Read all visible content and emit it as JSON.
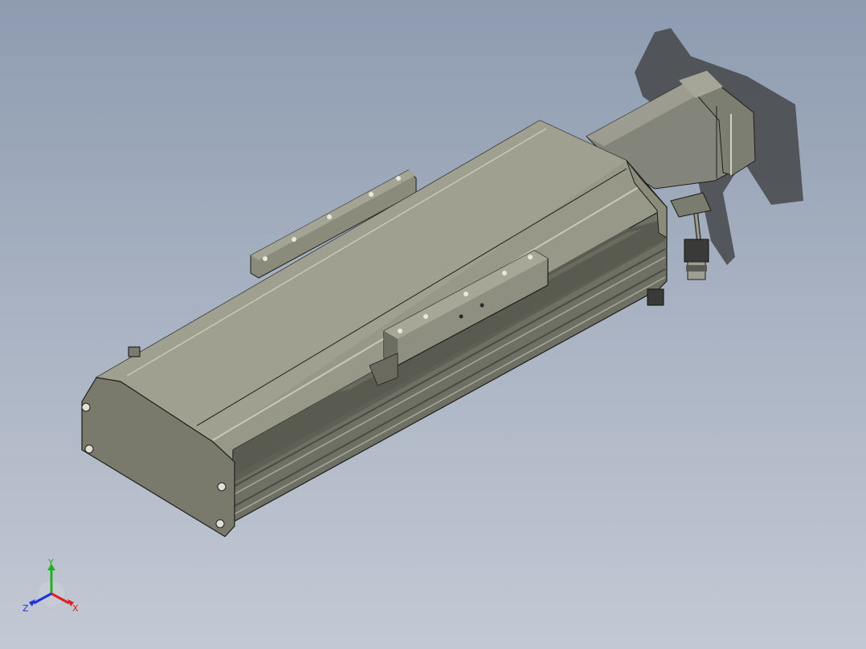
{
  "viewport": {
    "background_top": "#8e9bb0",
    "background_bottom": "#c3c9d4"
  },
  "model": {
    "body_color": "#8d8e7e",
    "top_color": "#9a9b8b",
    "end_cap_color": "#777868",
    "shadow_color": "#3d3f3c",
    "edge_color": "#1e1e1a"
  },
  "triad": {
    "x_label": "X",
    "y_label": "Y",
    "z_label": "Z",
    "x_color": "#e02020",
    "y_color": "#20b020",
    "z_color": "#2030e0"
  }
}
